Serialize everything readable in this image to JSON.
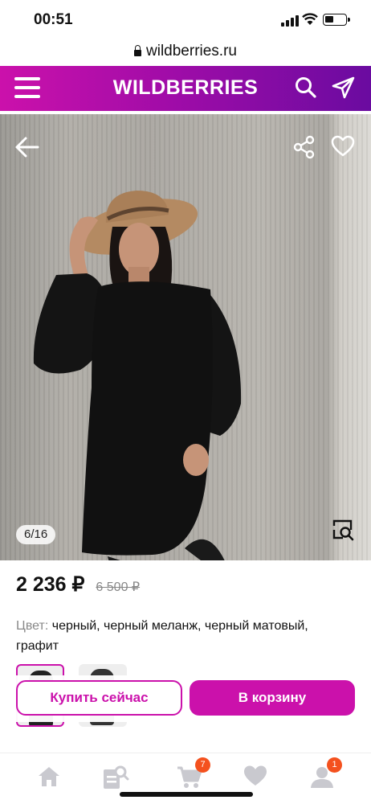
{
  "status_bar": {
    "time": "00:51"
  },
  "browser": {
    "url": "wildberries.ru"
  },
  "header": {
    "brand": "WILDBERRIES"
  },
  "gallery": {
    "counter": "6/16"
  },
  "product": {
    "price": "2 236 ₽",
    "old_price": "6 500 ₽",
    "color_label": "Цвет:",
    "color_value": " черный, черный меланж, черный матовый, графит"
  },
  "actions": {
    "buy_label": "Купить сейчас",
    "cart_label": "В корзину"
  },
  "bottom_nav": {
    "cart_badge": "7",
    "profile_badge": "1"
  },
  "colors": {
    "accent": "#cb11ab",
    "header_end": "#6a0ba0",
    "badge": "#f4511e",
    "nav_icon": "#c9c9cf"
  },
  "icons": [
    "menu-icon",
    "search-icon",
    "send-icon",
    "back-icon",
    "share-icon",
    "heart-icon",
    "zoom-icon",
    "home-icon",
    "catalog-icon",
    "cart-icon",
    "favorites-icon",
    "profile-icon"
  ]
}
